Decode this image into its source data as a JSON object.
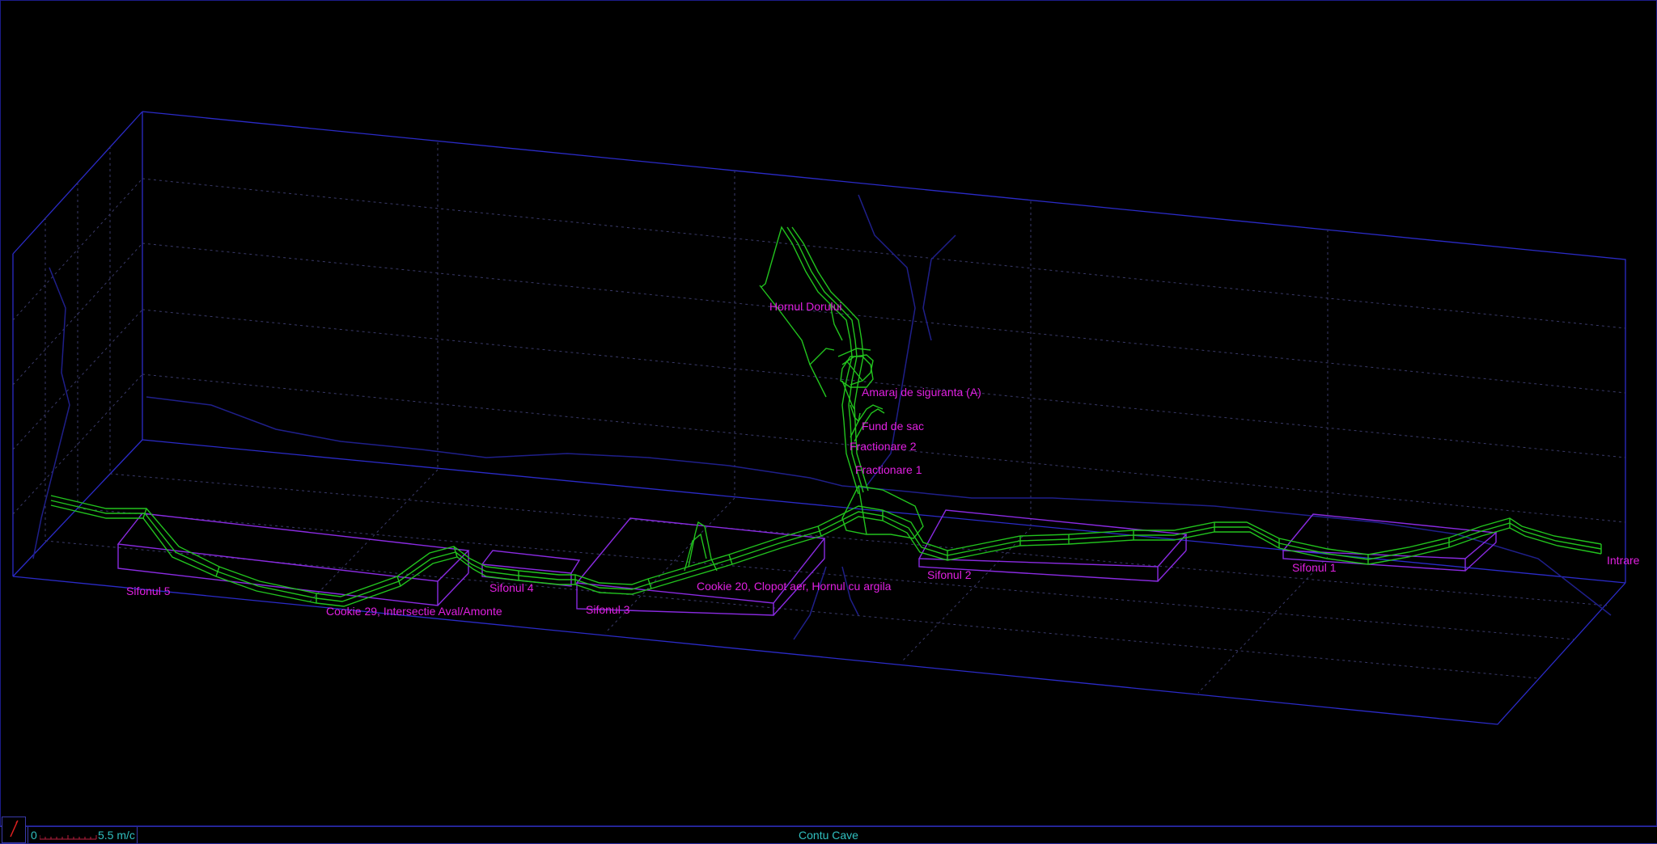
{
  "app": {
    "title": "Contu Cave"
  },
  "colors": {
    "background": "#000000",
    "grid": "#2b2bc8",
    "survey": "#22c31e",
    "label": "#e020e0",
    "sump_box": "#8a2be2",
    "status_text": "#30c0c0"
  },
  "labels": {
    "hornul_dorului": "Hornul Dorului",
    "amaraj": "Amaraj de siguranta (A)",
    "fund_de_sac": "Fund de sac",
    "fractionare_2": "Fractionare 2",
    "fractionare_1": "Fractionare 1",
    "sifonul_5": "Sifonul 5",
    "cookie_29": "Cookie 29, Intersectie Aval/Amonte",
    "sifonul_4": "Sifonul 4",
    "sifonul_3": "Sifonul 3",
    "cookie_20": "Cookie 20, Clopot aer, Hornul cu argila",
    "sifonul_2": "Sifonul 2",
    "sifonul_1": "Sifonul 1",
    "intrare": "Intrare"
  },
  "statusbar": {
    "scale_zero": "0",
    "scale_value": "5.5 m/c",
    "compass_icon": "north-arrow-icon"
  }
}
